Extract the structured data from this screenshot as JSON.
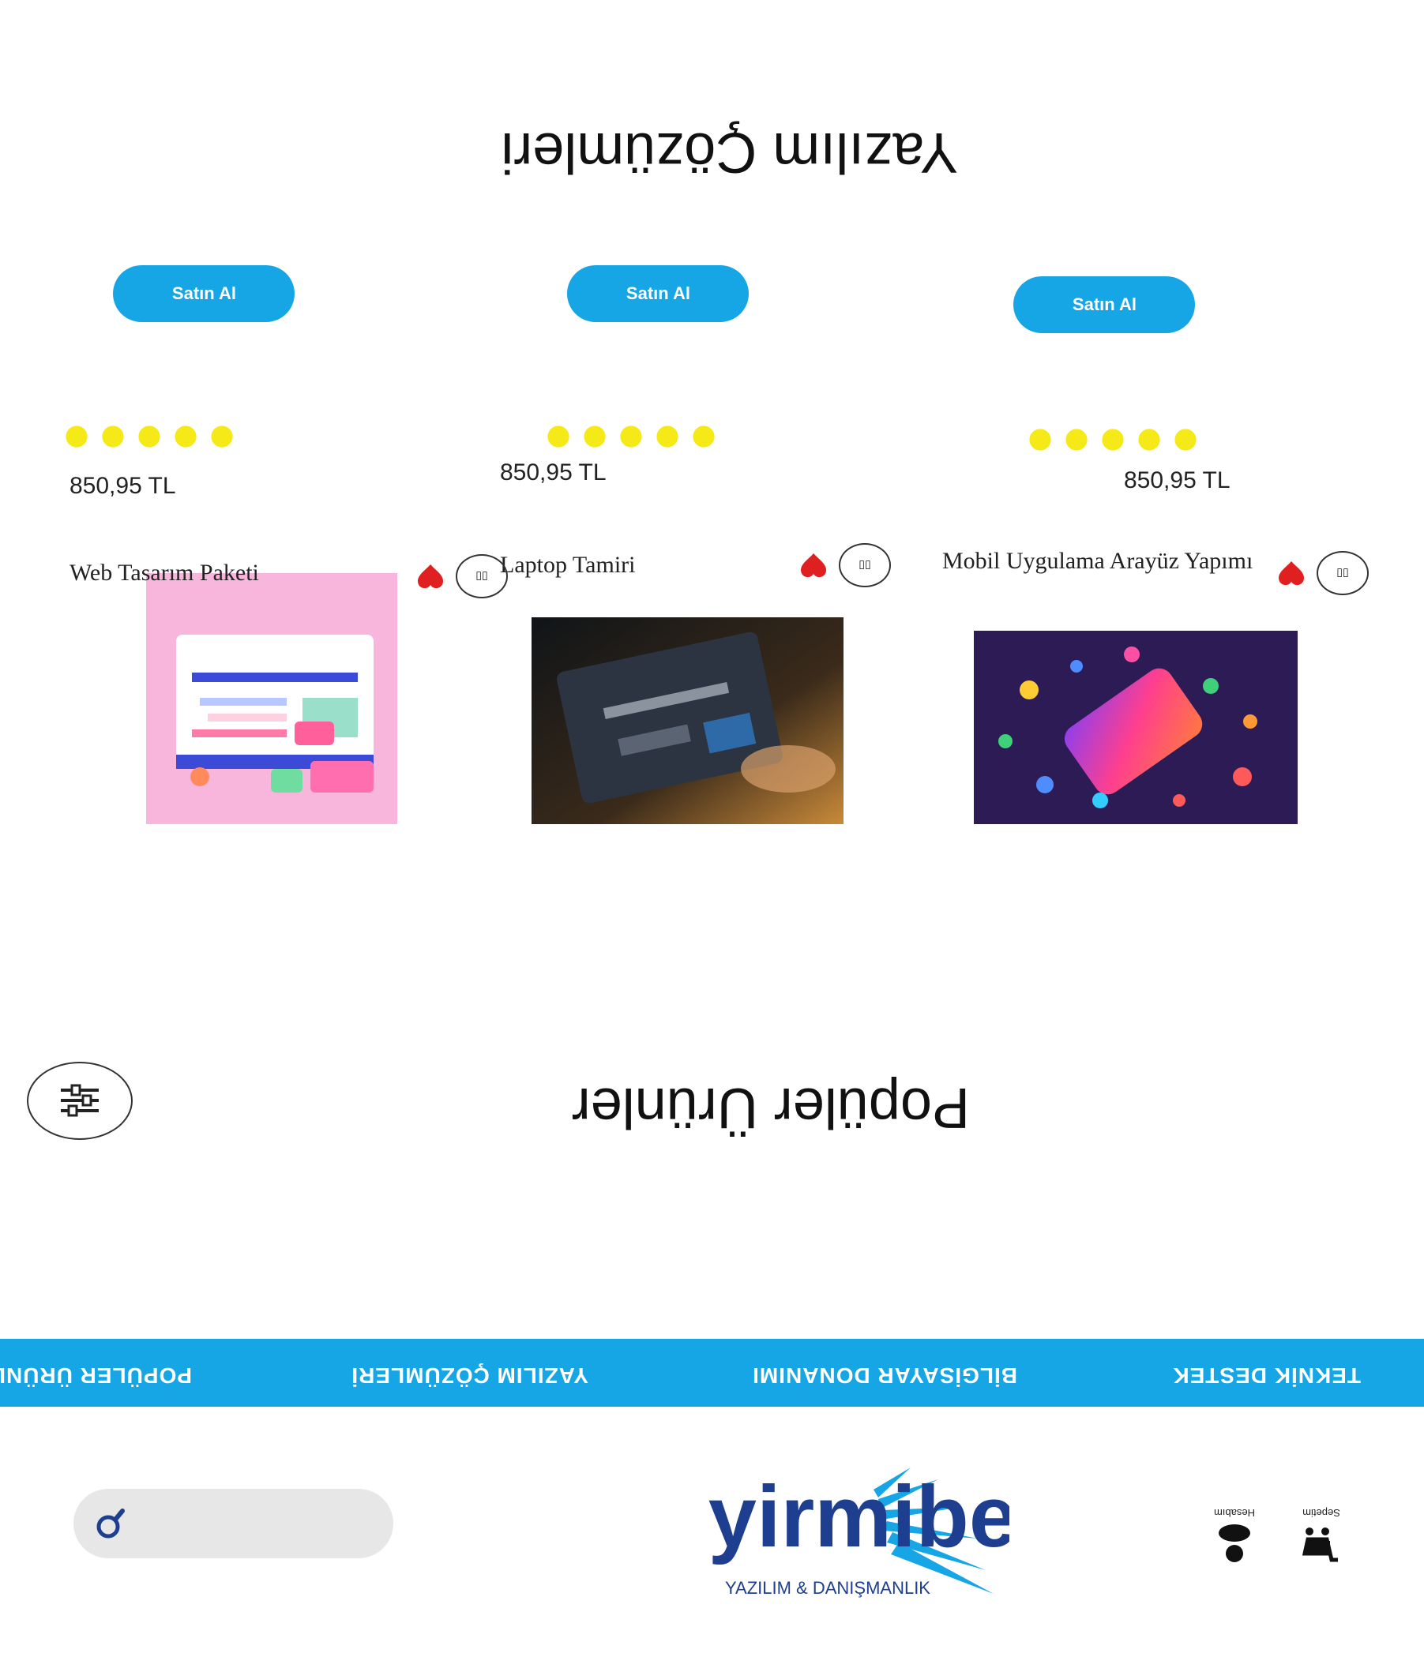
{
  "header": {
    "icons": [
      {
        "name": "cart-icon",
        "label": "Sepetim"
      },
      {
        "name": "user-icon",
        "label": "Hesabım"
      }
    ],
    "logo_text": "yirmibeş",
    "logo_subtitle": "YAZILIM & DANIŞMANLIK",
    "search": {
      "placeholder": ""
    }
  },
  "nav": {
    "items": [
      "TEKNİK DESTEK",
      "BİLGİSAYAR DONANIMI",
      "YAZILIM ÇÖZÜMLERİ",
      "POPÜLER ÜRÜNLER"
    ]
  },
  "popular": {
    "title": "Popüler Ürünler",
    "filter_label": "Filtre"
  },
  "software": {
    "title": "Yazılım Çözümleri",
    "products": [
      {
        "name": "Mobil Uygulama Arayüz Yapımı",
        "price": "850,95 TL",
        "rating": 5,
        "buy_label": "Satın Al"
      },
      {
        "name": "Laptop Tamiri",
        "price": "850,95 TL",
        "rating": 5,
        "buy_label": "Satın Al"
      },
      {
        "name": "Web Tasarım Paketi",
        "price": "850,95 TL",
        "rating": 5,
        "buy_label": "Satın Al"
      }
    ]
  },
  "colors": {
    "accent": "#16a6e6",
    "heart": "#e02020",
    "star": "#f5ea17",
    "logo_blue": "#1e3f8f"
  }
}
